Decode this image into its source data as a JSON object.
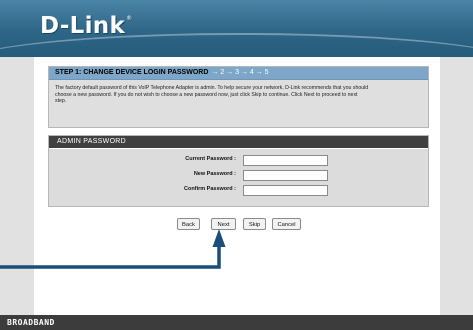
{
  "header": {
    "logo_text": "D-Link",
    "logo_mark": "®"
  },
  "step": {
    "title": "STEP 1: CHANGE DEVICE LOGIN PASSWORD",
    "arrows": "→ 2 → 3 → 4 → 5",
    "description_line1": "The factory default password of this VoIP Telephone Adapter is admin. To help secure your network, D-Link recommends that you should",
    "description_line2": "choose a new password. If you do not wish to choose a new password now, just click Skip to continue. Click Next to proceed to next",
    "description_line3": "step."
  },
  "admin_password": {
    "title": "ADMIN PASSWORD",
    "current_label": "Current Password :",
    "current_value": "",
    "new_label": "New Password :",
    "new_value": "",
    "confirm_label": "Confirm Password :",
    "confirm_value": ""
  },
  "buttons": {
    "back": "Back",
    "next": "Next",
    "skip": "Skip",
    "cancel": "Cancel"
  },
  "footer": {
    "text": "BROADBAND"
  },
  "colors": {
    "header": "#2e6687",
    "step_title_bar": "#7ea6c9",
    "admin_title_bar": "#404040",
    "footer": "#3c3c3c",
    "pointer": "#1c4e7a"
  },
  "icons": {
    "callout": "arrow-pointer-icon"
  }
}
